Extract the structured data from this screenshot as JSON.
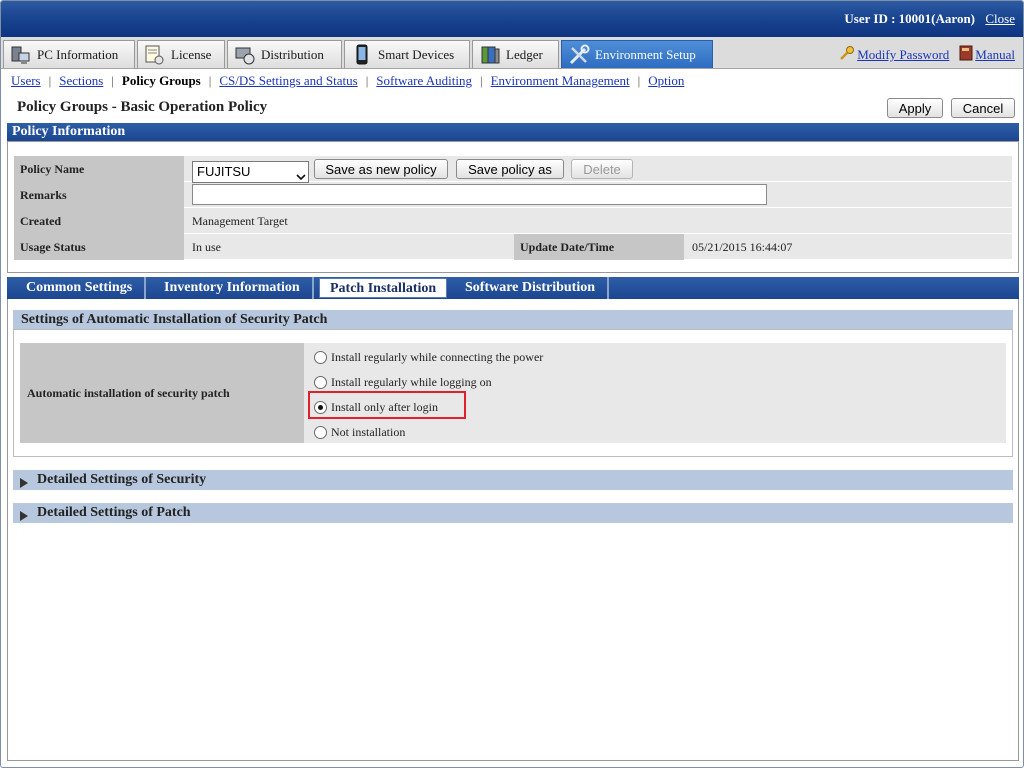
{
  "header": {
    "user_id": "User ID : 10001(Aaron)",
    "close": "Close"
  },
  "main_tabs": [
    {
      "label": "PC Information",
      "icon": "pc-icon"
    },
    {
      "label": "License",
      "icon": "license-icon"
    },
    {
      "label": "Distribution",
      "icon": "distribution-icon"
    },
    {
      "label": "Smart Devices",
      "icon": "smartphone-icon"
    },
    {
      "label": "Ledger",
      "icon": "ledger-icon"
    },
    {
      "label": "Environment Setup",
      "icon": "tools-icon",
      "active": true
    }
  ],
  "top_links": {
    "modify_password": "Modify Password",
    "manual": "Manual"
  },
  "subnav": {
    "items": [
      "Users",
      "Sections",
      "Policy Groups",
      "CS/DS Settings and Status",
      "Software Auditing",
      "Environment Management",
      "Option"
    ],
    "current": "Policy Groups"
  },
  "page": {
    "title": "Policy Groups - Basic Operation Policy",
    "apply": "Apply",
    "cancel": "Cancel"
  },
  "policy_info": {
    "header": "Policy Information",
    "labels": {
      "policy_name": "Policy Name",
      "remarks": "Remarks",
      "created": "Created",
      "usage_status": "Usage Status",
      "update_datetime": "Update Date/Time"
    },
    "policy_name_value": "FUJITSU",
    "save_as_new": "Save as new policy",
    "save_policy_as": "Save policy as",
    "delete": "Delete",
    "remarks_value": "",
    "created_value": "Management Target",
    "usage_status_value": "In use",
    "update_datetime_value": "05/21/2015 16:44:07"
  },
  "sub_tabs": [
    {
      "label": "Common Settings"
    },
    {
      "label": "Inventory Information"
    },
    {
      "label": "Patch Installation",
      "active": true
    },
    {
      "label": "Software Distribution"
    }
  ],
  "patch": {
    "section_title": "Settings of Automatic Installation of Security Patch",
    "row_label": "Automatic installation of security patch",
    "options": [
      "Install regularly  while connecting the power",
      "Install regularly  while logging on",
      "Install only after login",
      "Not installation"
    ],
    "selected_index": 2
  },
  "collapsibles": {
    "security": "Detailed Settings of Security",
    "patch": "Detailed Settings of Patch"
  },
  "colors": {
    "header_blue": "#1a4591",
    "active_tab_blue": "#2d6cc0",
    "band_blue": "#b7c7dd",
    "highlight_red": "#e0202a",
    "link_blue": "#1a35b8"
  }
}
